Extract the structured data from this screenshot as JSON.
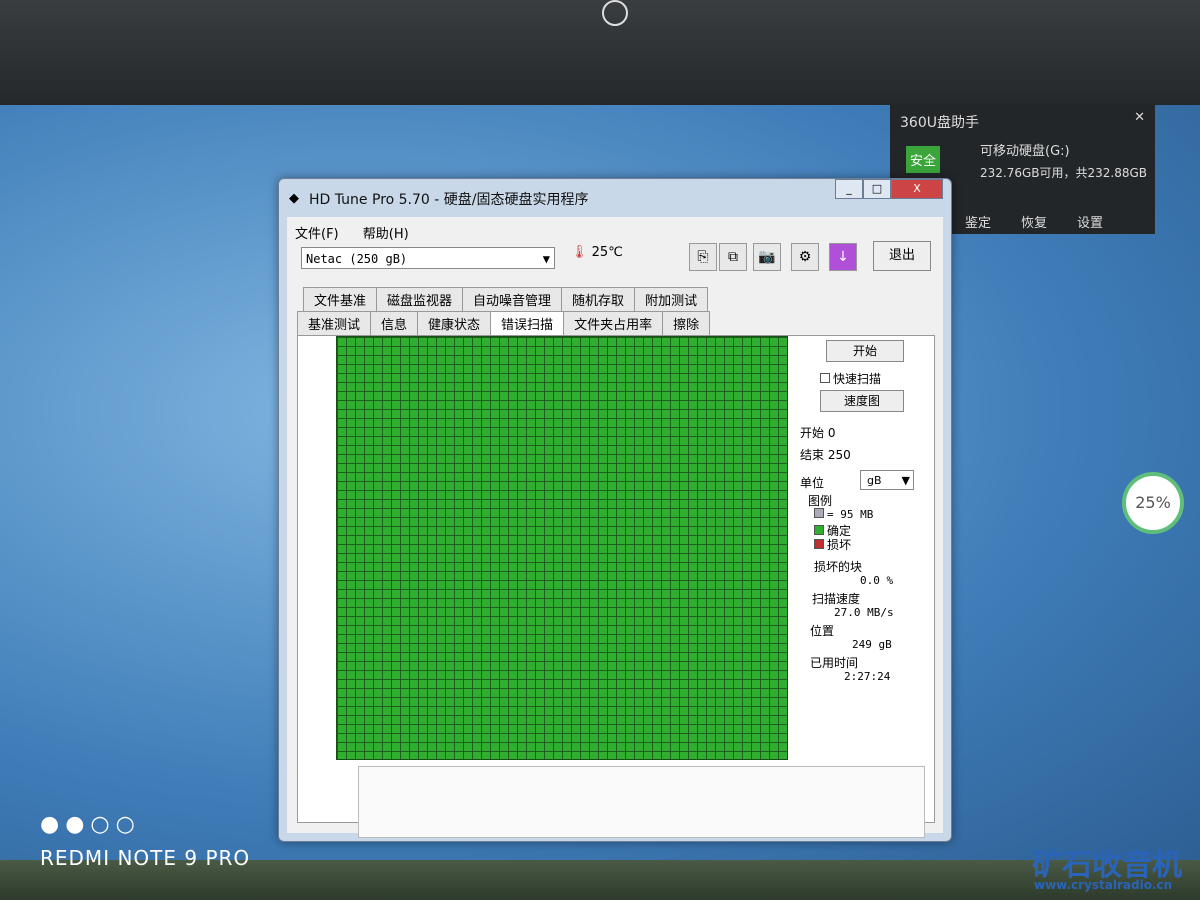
{
  "window": {
    "title": "HD Tune Pro 5.70 - 硬盘/固态硬盘实用程序",
    "minimize": "_",
    "maximize": "□",
    "close": "X"
  },
  "menu": [
    "文件(F)",
    "帮助(H)"
  ],
  "drive": "Netac (250 gB)",
  "temperature": "25℃",
  "exit_label": "退出",
  "tabs_row1": [
    "文件基准",
    "磁盘监视器",
    "自动噪音管理",
    "随机存取",
    "附加测试"
  ],
  "tabs_row2": [
    "基准测试",
    "信息",
    "健康状态",
    "错误扫描",
    "文件夹占用率",
    "擦除"
  ],
  "active_tab": "错误扫描",
  "scan": {
    "start_button": "开始",
    "quick_scan": "快速扫描",
    "speed_map": "速度图",
    "start_label": "开始",
    "start_value": "0",
    "end_label": "结束",
    "end_value": "250",
    "unit_label": "单位",
    "unit_value": "gB",
    "legend_title": "图例",
    "legend_block": "= 95 MB",
    "legend_ok": "确定",
    "legend_bad": "损坏",
    "damaged_label": "损坏的块",
    "damaged_value": "0.0 %",
    "speed_label": "扫描速度",
    "speed_value": "27.0 MB/s",
    "position_label": "位置",
    "position_value": "249 gB",
    "elapsed_label": "已用时间",
    "elapsed_value": "2:27:24",
    "ok_color": "#2fae2f",
    "bad_color": "#c03030"
  },
  "popup": {
    "title": "360U盘助手",
    "badge": "安全",
    "drive": "可移动硬盘(G:)",
    "capacity": "232.76GB可用，共232.88GB",
    "actions": [
      "鉴定",
      "恢复",
      "设置"
    ]
  },
  "cpu": {
    "value": "25%"
  },
  "watermark": {
    "phone": "REDMI NOTE 9 PRO",
    "site_cn": "矿石收音机",
    "site_url": "www.crystalradio.cn"
  }
}
